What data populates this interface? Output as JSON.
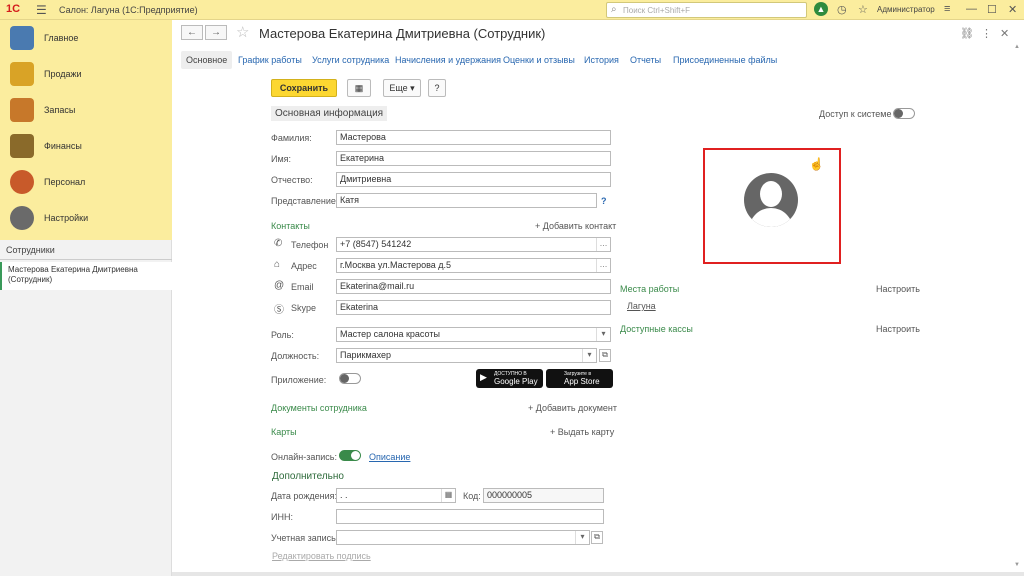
{
  "topbar": {
    "logo": "1С",
    "app_title": "Салон: Лагуна  (1С:Предприятие)",
    "search_placeholder": "Поиск Ctrl+Shift+F",
    "user": "Администратор"
  },
  "sidebar": {
    "items": [
      {
        "label": "Главное",
        "icon": "clipboard-icon",
        "color": "#4a7ab0"
      },
      {
        "label": "Продажи",
        "icon": "chart-icon",
        "color": "#d9a326"
      },
      {
        "label": "Запасы",
        "icon": "box-icon",
        "color": "#c7782a"
      },
      {
        "label": "Финансы",
        "icon": "wallet-icon",
        "color": "#8a6a2a"
      },
      {
        "label": "Персонал",
        "icon": "people-icon",
        "color": "#c85a2a"
      },
      {
        "label": "Настройки",
        "icon": "gear-icon",
        "color": "#6a6a6a"
      }
    ]
  },
  "leftpane": {
    "title": "Сотрудники",
    "item": "Мастерова Екатерина Дмитриевна (Сотрудник)"
  },
  "form": {
    "title": "Мастерова Екатерина Дмитриевна (Сотрудник)",
    "tabs": [
      "Основное",
      "График работы",
      "Услуги сотрудника",
      "Начисления и удержания",
      "Оценки и отзывы",
      "История",
      "Отчеты",
      "Присоединенные файлы"
    ],
    "save_label": "Сохранить",
    "more_label": "Еще",
    "help_label": "?",
    "section_title": "Основная информация",
    "access_label": "Доступ к системе",
    "fields": {
      "lastname_label": "Фамилия:",
      "lastname": "Мастерова",
      "firstname_label": "Имя:",
      "firstname": "Екатерина",
      "middlename_label": "Отчество:",
      "middlename": "Дмитриевна",
      "display_label": "Представление:",
      "display": "Катя"
    },
    "contacts": {
      "header": "Контакты",
      "add": "+ Добавить контакт",
      "phone_label": "Телефон",
      "phone": "+7 (8547) 541242",
      "address_label": "Адрес",
      "address": "г.Москва ул.Мастерова д.5",
      "email_label": "Email",
      "email": "Ekaterina@mail.ru",
      "skype_label": "Skype",
      "skype": "Ekaterina"
    },
    "role_label": "Роль:",
    "role": "Мастер салона красоты",
    "position_label": "Должность:",
    "position": "Парикмахер",
    "app_label": "Приложение:",
    "google_small": "ДОСТУПНО В",
    "google_big": "Google Play",
    "apple_small": "Загрузите в",
    "apple_big": "App Store",
    "docs_header": "Документы сотрудника",
    "docs_add": "+ Добавить документ",
    "cards_header": "Карты",
    "cards_add": "+ Выдать карту",
    "online_label": "Онлайн-запись:",
    "online_link": "Описание",
    "extra_header": "Дополнительно",
    "birth_label": "Дата рождения:",
    "birth": " .  .",
    "code_label": "Код:",
    "code": "000000005",
    "inn_label": "ИНН:",
    "inn": "",
    "account_label": "Учетная запись:",
    "account": "",
    "edit_signature": "Редактировать подпись",
    "workplaces_header": "Места работы",
    "workplaces_config": "Настроить",
    "workplace": "Лагуна",
    "cash_header": "Доступные кассы",
    "cash_config": "Настроить"
  }
}
